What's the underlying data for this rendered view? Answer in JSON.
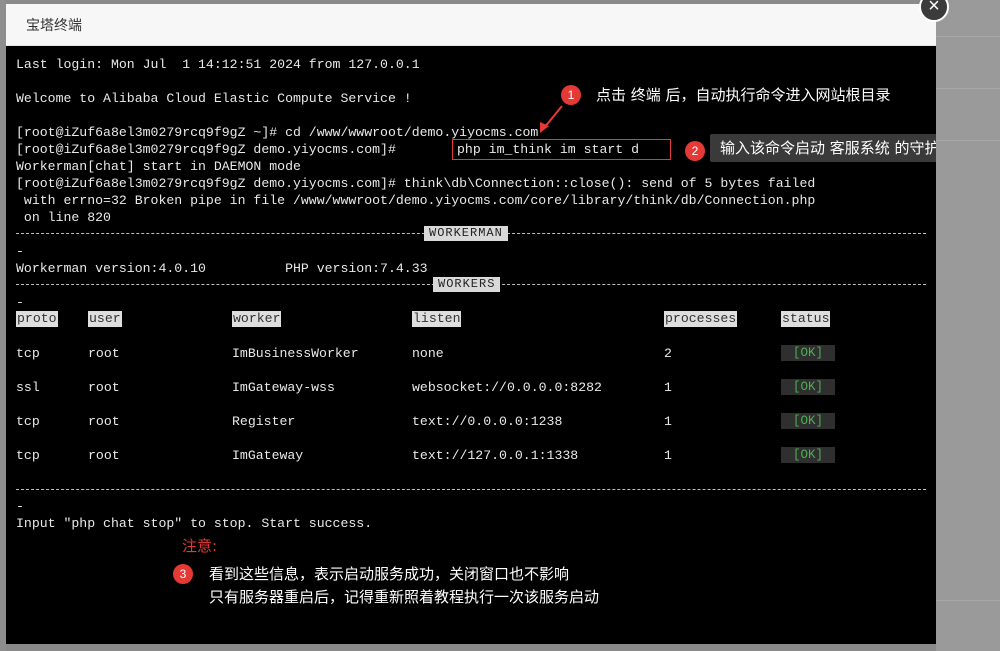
{
  "window": {
    "title": "宝塔终端",
    "close_glyph": "×"
  },
  "terminal": {
    "lines": [
      "Last login: Mon Jul  1 14:12:51 2024 from 127.0.0.1",
      "Welcome to Alibaba Cloud Elastic Compute Service !",
      "[root@iZuf6a8el3m0279rcq9f9gZ ~]# cd /www/wwwroot/demo.yiyocms.com",
      "[root@iZuf6a8el3m0279rcq9f9gZ demo.yiyocms.com]# ",
      "php im_think im start d",
      "Workerman[chat] start in DAEMON mode",
      "[root@iZuf6a8el3m0279rcq9f9gZ demo.yiyocms.com]# think\\db\\Connection::close(): send of 5 bytes failed",
      " with errno=32 Broken pipe in file /www/wwwroot/demo.yiyocms.com/core/library/think/db/Connection.php",
      " on line 820",
      "Workerman version:4.0.10          PHP version:7.4.33",
      "Input \"php chat stop\" to stop. Start success.",
      "-"
    ],
    "sections": {
      "workerman": "WORKERMAN",
      "workers": "WORKERS"
    },
    "table": {
      "headers": [
        "proto",
        "user",
        "worker",
        "listen",
        "processes",
        "status"
      ],
      "rows": [
        [
          "tcp",
          "root",
          "ImBusinessWorker",
          "none",
          "2",
          "[OK]"
        ],
        [
          "ssl",
          "root",
          "ImGateway-wss",
          "websocket://0.0.0.0:8282",
          "1",
          "[OK]"
        ],
        [
          "tcp",
          "root",
          "Register",
          "text://0.0.0.0:1238",
          "1",
          "[OK]"
        ],
        [
          "tcp",
          "root",
          "ImGateway",
          "text://127.0.0.1:1338",
          "1",
          "[OK]"
        ]
      ]
    }
  },
  "annotations": {
    "a1": {
      "num": "1",
      "text": "点击 终端 后，自动执行命令进入网站根目录"
    },
    "a2": {
      "num": "2",
      "text": "输入该命令启动 客服系统 的守护进程"
    },
    "a3": {
      "label": "注意:",
      "num": "3",
      "line1": "看到这些信息，表示启动服务成功，关闭窗口也不影响",
      "line2": "只有服务器重启后，记得重新照着教程执行一次该服务启动"
    }
  },
  "colors": {
    "annotation_red": "#e53935",
    "ok_green": "#4caf50",
    "terminal_bg": "#000000"
  }
}
